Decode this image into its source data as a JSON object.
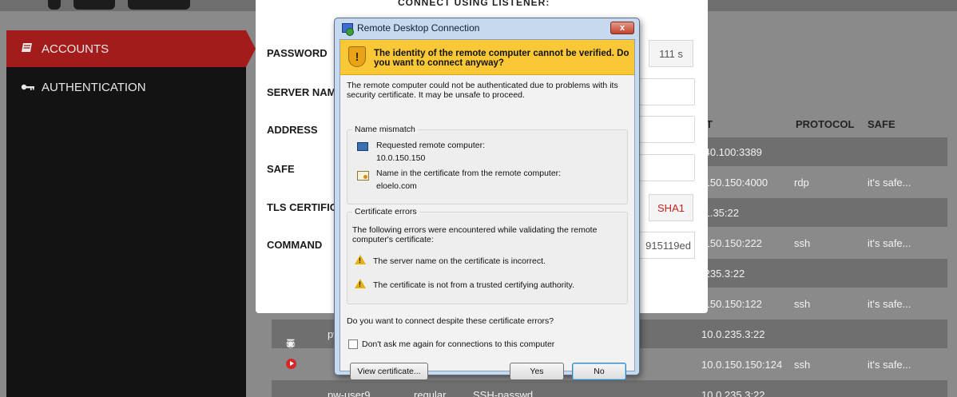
{
  "app": {
    "sidebar": {
      "items": [
        {
          "label": "ACCOUNTS",
          "icon": "book-icon"
        },
        {
          "label": "AUTHENTICATION",
          "icon": "key-icon"
        }
      ],
      "active_color": "#a31b1b"
    },
    "table": {
      "headers": {
        "target": "T",
        "protocol": "PROTOCOL",
        "safe": "SAFE"
      },
      "rows": [
        {
          "target": ".40.100:3389",
          "protocol": "",
          "safe": ""
        },
        {
          "target": ".150.150:4000",
          "protocol": "rdp",
          "safe": "it's safe..."
        },
        {
          "target": ".1.35:22",
          "protocol": "",
          "safe": ""
        },
        {
          "target": ".150.150:222",
          "protocol": "ssh",
          "safe": "it's safe..."
        },
        {
          "target": ".235.3:22",
          "protocol": "",
          "safe": ""
        },
        {
          "target": ".150.150:122",
          "protocol": "ssh",
          "safe": "it's safe..."
        },
        {
          "user": "pw-",
          "target": "10.0.235.3:22",
          "protocol": "",
          "safe": ""
        },
        {
          "target": "10.0.150.150:124",
          "protocol": "ssh",
          "safe": "it's safe..."
        },
        {
          "user": "pw-user9",
          "type": "regular",
          "auth": "SSH-passwd",
          "target": "10.0.235.3:22",
          "protocol": "",
          "safe": ""
        }
      ]
    }
  },
  "form": {
    "heading": "CONNECT USING LISTENER:",
    "fields": [
      {
        "label": "PASSWORD",
        "suffix": "111 s"
      },
      {
        "label": "SERVER NAMI"
      },
      {
        "label": "ADDRESS"
      },
      {
        "label": "SAFE"
      },
      {
        "label": "TLS CERTIFIC",
        "suffix": "SHA1"
      },
      {
        "label": "COMMAND",
        "value": "915119ed"
      }
    ]
  },
  "dialog": {
    "title": "Remote Desktop Connection",
    "close_label": "x",
    "warning": "The identity of the remote computer cannot be verified. Do you want to connect anyway?",
    "description": "The remote computer could not be authenticated due to problems with its security certificate. It may be unsafe to proceed.",
    "name_mismatch": {
      "legend": "Name mismatch",
      "requested_label": "Requested remote computer:",
      "requested_value": "10.0.150.150",
      "cert_label": "Name in the certificate from the remote computer:",
      "cert_value": "eloelo.com"
    },
    "cert_errors": {
      "legend": "Certificate errors",
      "intro": "The following errors were encountered while validating the remote computer's certificate:",
      "errors": [
        "The server name on the certificate is incorrect.",
        "The certificate is not from a trusted certifying authority."
      ]
    },
    "question": "Do you want to connect despite these certificate errors?",
    "checkbox_label": "Don't ask me again for connections to this computer",
    "buttons": {
      "view_cert": "View certificate...",
      "yes": "Yes",
      "no": "No"
    },
    "banner_color": "#fac736"
  }
}
